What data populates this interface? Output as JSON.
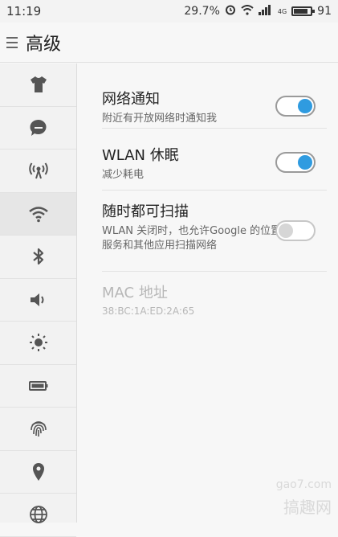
{
  "status_bar": {
    "time": "11:19",
    "percent": "29.7%",
    "network": "4G",
    "battery": "91"
  },
  "header": {
    "title": "高级"
  },
  "sidebar": {
    "icons": [
      "shirt-icon",
      "chat-bubble-icon",
      "hotspot-icon",
      "wifi-icon",
      "bluetooth-icon",
      "speaker-icon",
      "brightness-icon",
      "battery-icon",
      "fingerprint-icon",
      "location-icon",
      "globe-icon"
    ],
    "active_index": 3
  },
  "settings": {
    "network_notify": {
      "title": "网络通知",
      "subtitle": "附近有开放网络时通知我",
      "enabled": true
    },
    "wlan_sleep": {
      "title": "WLAN 休眠",
      "subtitle": "减少耗电",
      "enabled": true
    },
    "scan_anytime": {
      "title": "随时都可扫描",
      "subtitle": "WLAN 关闭时，也允许Google 的位置服务和其他应用扫描网络",
      "enabled": false
    },
    "mac": {
      "title": "MAC 地址",
      "value": "38:BC:1A:ED:2A:65"
    }
  },
  "watermark": {
    "site": "gao7.com",
    "brand": "搞趣网"
  },
  "colors": {
    "accent": "#2f9be0",
    "background": "#f7f7f7"
  }
}
